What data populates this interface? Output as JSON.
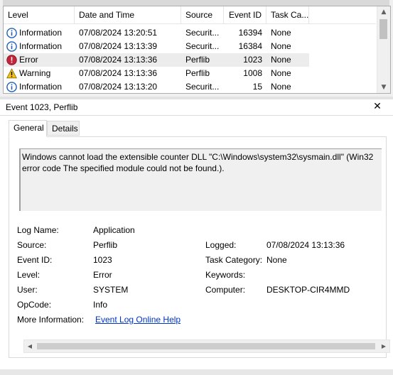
{
  "event_list": {
    "columns": [
      "Level",
      "Date and Time",
      "Source",
      "Event ID",
      "Task Ca..."
    ],
    "rows": [
      {
        "level": "Information",
        "icon": "info-icon",
        "datetime": "07/08/2024 13:20:51",
        "source": "Securit...",
        "event_id": "16394",
        "task": "None",
        "selected": false
      },
      {
        "level": "Information",
        "icon": "info-icon",
        "datetime": "07/08/2024 13:13:39",
        "source": "Securit...",
        "event_id": "16384",
        "task": "None",
        "selected": false
      },
      {
        "level": "Error",
        "icon": "error-icon",
        "datetime": "07/08/2024 13:13:36",
        "source": "Perflib",
        "event_id": "1023",
        "task": "None",
        "selected": true
      },
      {
        "level": "Warning",
        "icon": "warning-icon",
        "datetime": "07/08/2024 13:13:36",
        "source": "Perflib",
        "event_id": "1008",
        "task": "None",
        "selected": false
      },
      {
        "level": "Information",
        "icon": "info-icon",
        "datetime": "07/08/2024 13:13:20",
        "source": "Securit...",
        "event_id": "15",
        "task": "None",
        "selected": false
      }
    ]
  },
  "detail": {
    "title": "Event 1023, Perflib",
    "tabs": [
      "General",
      "Details"
    ],
    "description": "Windows cannot load the extensible counter DLL \"C:\\Windows\\system32\\sysmain.dll\" (Win32 error code The specified module could not be found.).",
    "fields": {
      "log_name_label": "Log Name:",
      "log_name": "Application",
      "source_label": "Source:",
      "source": "Perflib",
      "logged_label": "Logged:",
      "logged": "07/08/2024 13:13:36",
      "event_id_label": "Event ID:",
      "event_id": "1023",
      "task_category_label": "Task Category:",
      "task_category": "None",
      "level_label": "Level:",
      "level": "Error",
      "keywords_label": "Keywords:",
      "keywords": "",
      "user_label": "User:",
      "user": "SYSTEM",
      "computer_label": "Computer:",
      "computer": "DESKTOP-CIR4MMD",
      "opcode_label": "OpCode:",
      "opcode": "Info",
      "more_info_label": "More Information:",
      "more_info_link": "Event Log Online Help"
    }
  },
  "colors": {
    "info": "#1f5fb8",
    "error": "#c4253b",
    "warning": "#f2c21b",
    "link": "#0033cc"
  }
}
